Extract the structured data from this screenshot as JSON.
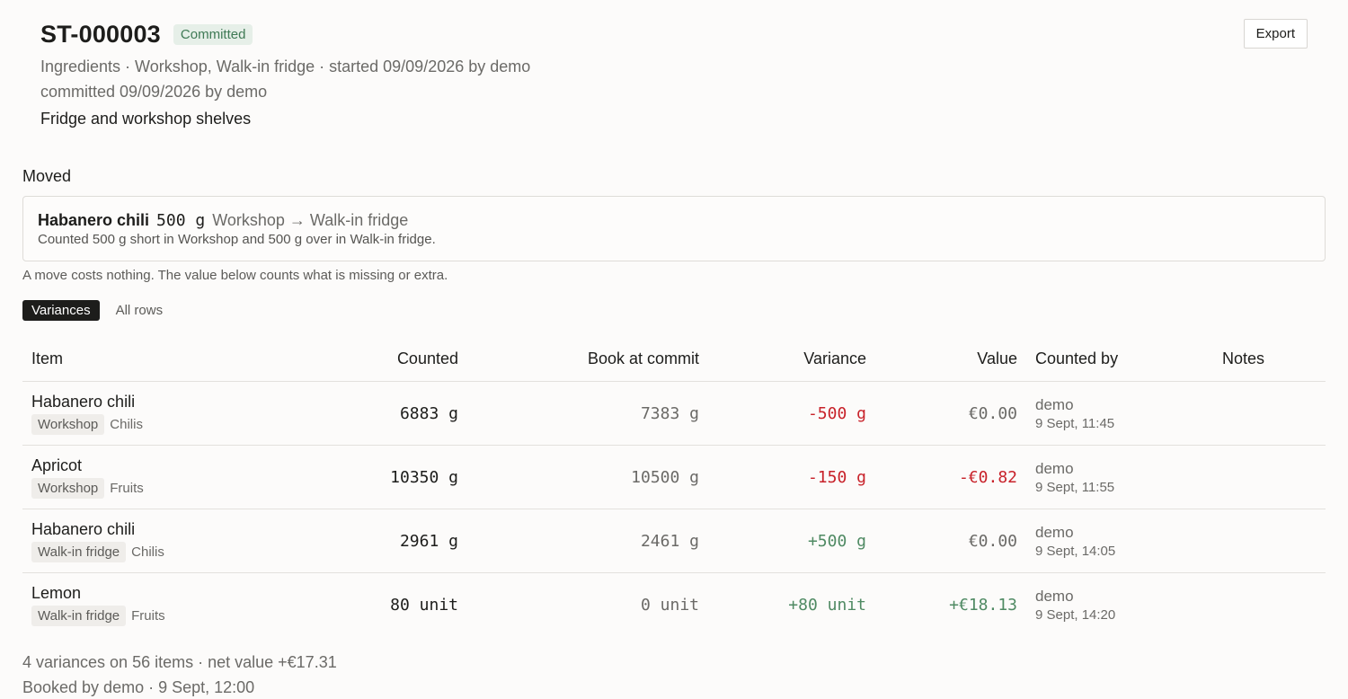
{
  "header": {
    "title": "ST-000003",
    "status": "Committed",
    "export_label": "Export",
    "meta_line": "Ingredients · Workshop, Walk-in fridge · started 09/09/2026 by demo",
    "committed_line": "committed 09/09/2026 by demo",
    "description": "Fridge and workshop shelves"
  },
  "moved": {
    "label": "Moved",
    "item": "Habanero chili",
    "qty": "500 g",
    "route": "Workshop → Walk-in fridge",
    "detail": "Counted 500 g short in Workshop and 500 g over in Walk-in fridge.",
    "note": "A move costs nothing. The value below counts what is missing or extra."
  },
  "tabs": [
    {
      "label": "Variances",
      "active": true
    },
    {
      "label": "All rows",
      "active": false
    }
  ],
  "table": {
    "columns": [
      "Item",
      "Counted",
      "Book at commit",
      "Variance",
      "Value",
      "Counted by",
      "Notes"
    ],
    "rows": [
      {
        "item": "Habanero chili",
        "location": "Workshop",
        "category": "Chilis",
        "counted": "6883 g",
        "book": "7383 g",
        "variance": "-500 g",
        "variance_sign": "neg",
        "value": "€0.00",
        "value_sign": "zero",
        "by": "demo",
        "time": "9 Sept, 11:45",
        "notes": ""
      },
      {
        "item": "Apricot",
        "location": "Workshop",
        "category": "Fruits",
        "counted": "10350 g",
        "book": "10500 g",
        "variance": "-150 g",
        "variance_sign": "neg",
        "value": "-€0.82",
        "value_sign": "neg",
        "by": "demo",
        "time": "9 Sept, 11:55",
        "notes": ""
      },
      {
        "item": "Habanero chili",
        "location": "Walk-in fridge",
        "category": "Chilis",
        "counted": "2961 g",
        "book": "2461 g",
        "variance": "+500 g",
        "variance_sign": "pos",
        "value": "€0.00",
        "value_sign": "zero",
        "by": "demo",
        "time": "9 Sept, 14:05",
        "notes": ""
      },
      {
        "item": "Lemon",
        "location": "Walk-in fridge",
        "category": "Fruits",
        "counted": "80 unit",
        "book": "0 unit",
        "variance": "+80 unit",
        "variance_sign": "pos",
        "value": "+€18.13",
        "value_sign": "pos",
        "by": "demo",
        "time": "9 Sept, 14:20",
        "notes": ""
      }
    ]
  },
  "footer": {
    "summary": "4 variances on 56 items · net value +€17.31",
    "booked": "Booked by demo · 9 Sept, 12:00"
  }
}
